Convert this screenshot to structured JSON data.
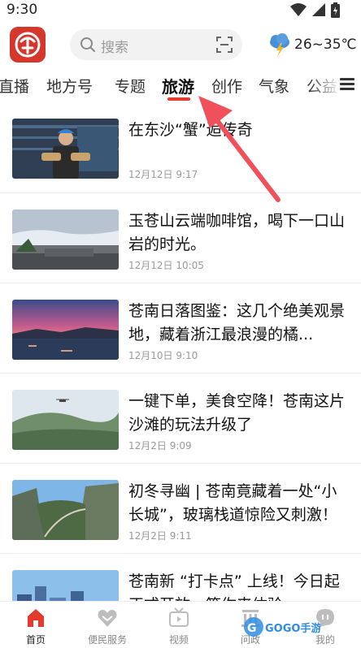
{
  "status_bar": {
    "time": "9:30"
  },
  "header": {
    "search_placeholder": "搜索",
    "weather": "26~35℃",
    "icons": [
      "app-logo-icon",
      "search-icon",
      "scan-icon",
      "weather-storm-icon"
    ]
  },
  "tabs": [
    {
      "label": "直播"
    },
    {
      "label": "地方号"
    },
    {
      "label": "专题"
    },
    {
      "label": "旅游",
      "active": true
    },
    {
      "label": "创作"
    },
    {
      "label": "气象"
    },
    {
      "label": "公益"
    }
  ],
  "articles": [
    {
      "title": "在东沙“蟹”逅传奇",
      "date": "12月12日 9:17"
    },
    {
      "title": "玉苍山云端咖啡馆，喝下一口山岩的时光。",
      "date": "12月12日 10:05"
    },
    {
      "title": "苍南日落图鉴：这几个绝美观景地，藏着浙江最浪漫的橘...",
      "date": "12月10日 9:10"
    },
    {
      "title": "一键下单，美食空降！苍南这片沙滩的玩法升级了",
      "date": "12月2日 9:09"
    },
    {
      "title": "初冬寻幽 | 苍南竟藏着一处“小长城”，玻璃栈道惊险又刺激！",
      "date": "12月2日 9:11"
    },
    {
      "title": "苍南新 “打卡点” 上线！今日起正式开放，等你来体验",
      "date": ""
    }
  ],
  "bottom_nav": [
    {
      "label": "首页",
      "icon": "home-icon",
      "active": true
    },
    {
      "label": "便民服务",
      "icon": "heart-icon"
    },
    {
      "label": "视频",
      "icon": "tv-icon"
    },
    {
      "label": "问政",
      "icon": "building-icon"
    },
    {
      "label": "我的",
      "icon": "chat-icon"
    }
  ],
  "watermark": {
    "brand": "GOGO手游网"
  },
  "colors": {
    "accent": "#e43a2d",
    "logo": "#d6372c",
    "weather_cloud": "#4a90d9",
    "weather_bolt": "#f5b82e"
  }
}
